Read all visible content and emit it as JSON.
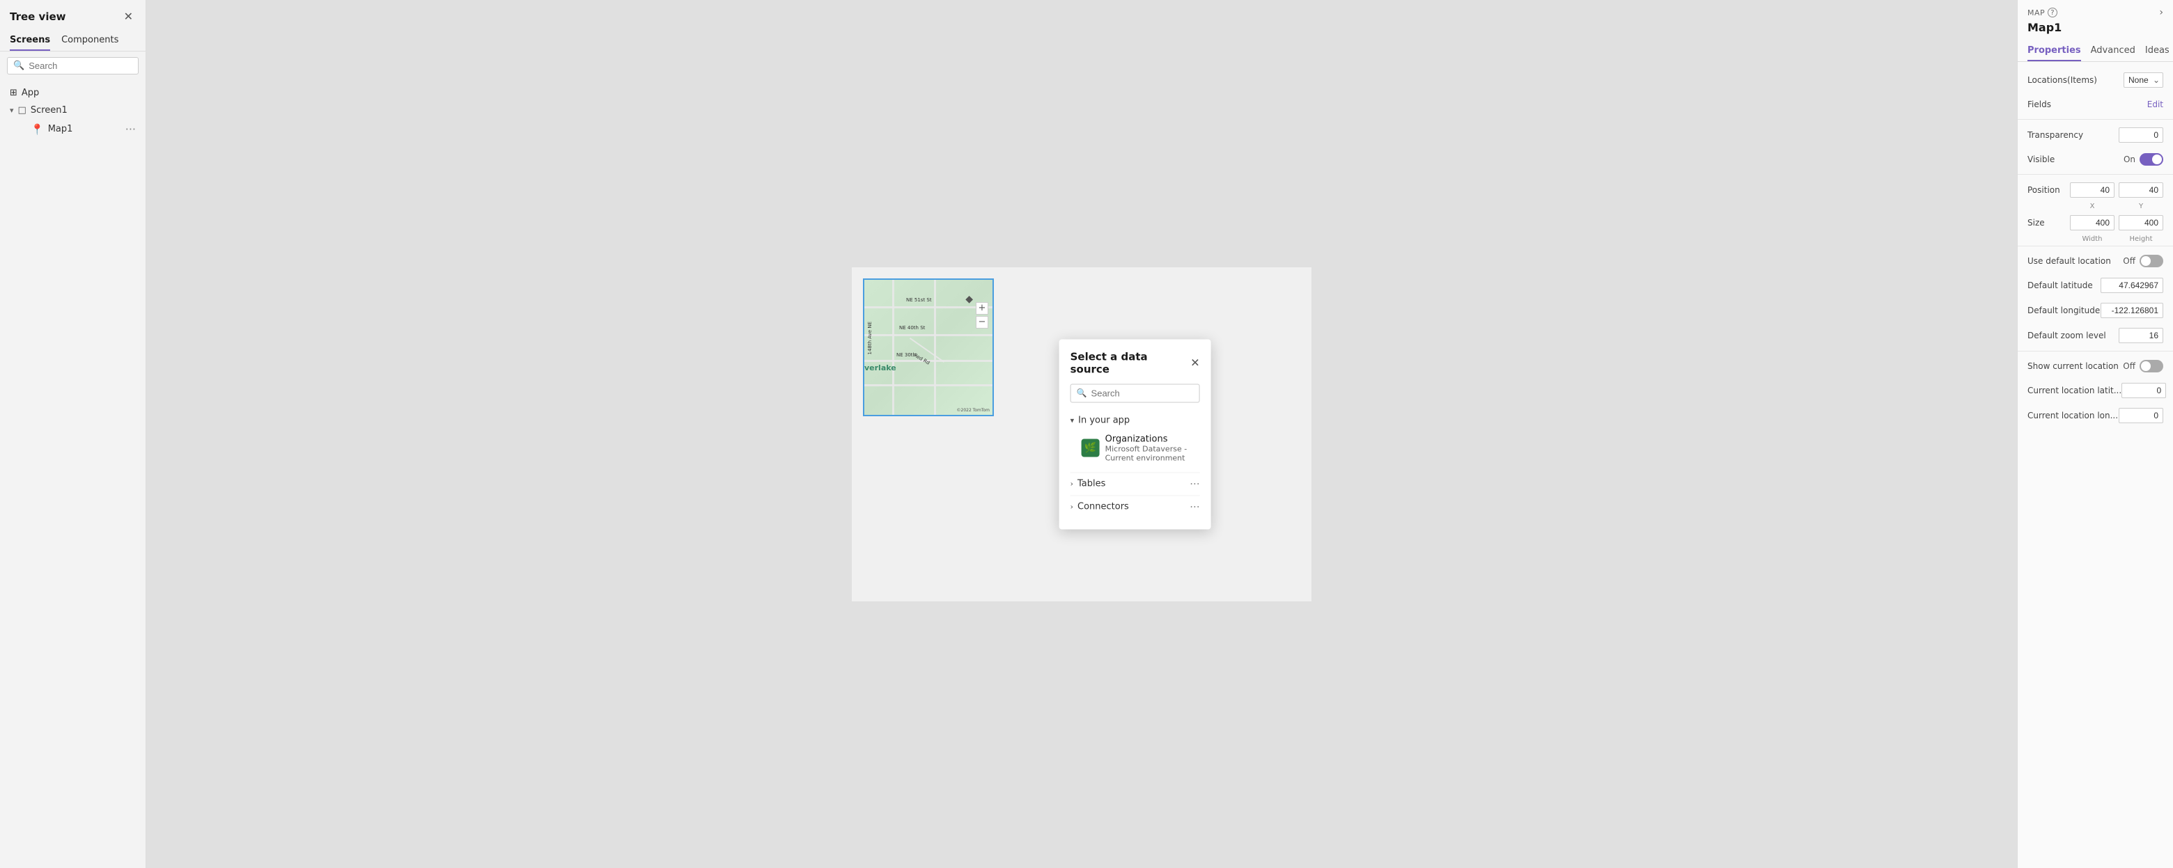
{
  "leftPanel": {
    "title": "Tree view",
    "tabs": [
      {
        "id": "screens",
        "label": "Screens",
        "active": true
      },
      {
        "id": "components",
        "label": "Components",
        "active": false
      }
    ],
    "searchPlaceholder": "Search",
    "treeItems": [
      {
        "id": "app",
        "label": "App",
        "type": "app",
        "level": 0
      },
      {
        "id": "screen1",
        "label": "Screen1",
        "type": "screen",
        "level": 0,
        "expanded": true
      },
      {
        "id": "map1",
        "label": "Map1",
        "type": "map",
        "level": 1
      }
    ]
  },
  "dialog": {
    "title": "Select a data source",
    "searchPlaceholder": "Search",
    "sections": {
      "inYourApp": {
        "label": "In your app",
        "expanded": true,
        "items": [
          {
            "id": "organizations",
            "name": "Organizations",
            "subtitle": "Microsoft Dataverse - Current environment",
            "icon": "🌿"
          }
        ]
      },
      "tables": {
        "label": "Tables",
        "expanded": false
      },
      "connectors": {
        "label": "Connectors",
        "expanded": false
      }
    }
  },
  "rightPanel": {
    "tag": "MAP",
    "helpIcon": "?",
    "chevronIcon": "›",
    "componentName": "Map1",
    "tabs": [
      {
        "id": "properties",
        "label": "Properties",
        "active": true
      },
      {
        "id": "advanced",
        "label": "Advanced",
        "active": false
      },
      {
        "id": "ideas",
        "label": "Ideas",
        "active": false
      }
    ],
    "properties": {
      "locationsLabel": "Locations(Items)",
      "locationsValue": "None",
      "fieldsLabel": "Fields",
      "fieldsValue": "Edit",
      "transparencyLabel": "Transparency",
      "transparencyValue": "0",
      "visibleLabel": "Visible",
      "visibleOn": "On",
      "visibleState": true,
      "positionLabel": "Position",
      "positionX": "40",
      "positionY": "40",
      "xLabel": "X",
      "yLabel": "Y",
      "sizeLabel": "Size",
      "sizeWidth": "400",
      "sizeHeight": "400",
      "widthLabel": "Width",
      "heightLabel": "Height",
      "useDefaultLocationLabel": "Use default location",
      "useDefaultLocationState": false,
      "useDefaultLocationOff": "Off",
      "defaultLatitudeLabel": "Default latitude",
      "defaultLatitudeValue": "47.642967",
      "defaultLongitudeLabel": "Default longitude",
      "defaultLongitudeValue": "-122.126801",
      "defaultZoomLabel": "Default zoom level",
      "defaultZoomValue": "16",
      "showCurrentLocationLabel": "Show current location",
      "showCurrentLocationState": false,
      "showCurrentLocationOff": "Off",
      "currentLocationLatLabel": "Current location latit...",
      "currentLocationLatValue": "0",
      "currentLocationLonLabel": "Current location lon...",
      "currentLocationLonValue": "0"
    }
  },
  "map": {
    "copyright": "©2022 TomTom",
    "labels": [
      "NE 51st St",
      "NE 40th St",
      "NE 30th",
      "148th Ave NE",
      "Red Rd"
    ],
    "cityLabel": "verlake"
  },
  "icons": {
    "close": "✕",
    "search": "🔍",
    "chevronDown": "⌄",
    "chevronRight": "›",
    "more": "···",
    "plus": "+",
    "minus": "−",
    "mapPin": "◆",
    "help": "?"
  }
}
